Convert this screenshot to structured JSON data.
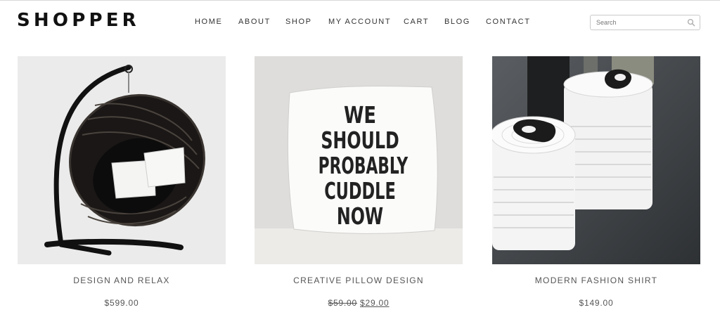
{
  "header": {
    "logo": "SHOPPER",
    "nav": [
      "HOME",
      "ABOUT",
      "SHOP",
      "MY ACCOUNT",
      "CART",
      "BLOG",
      "CONTACT"
    ],
    "search": {
      "placeholder": "Search",
      "value": ""
    }
  },
  "products": [
    {
      "name": "DESIGN AND RELAX",
      "price": "$599.00",
      "image": "hanging-egg-chair"
    },
    {
      "name": "CREATIVE PILLOW DESIGN",
      "old_price": "$59.00",
      "price": "$29.00",
      "image": "pillow",
      "pillow_text": [
        "WE",
        "SHOULD",
        "PROBABLY",
        "CUDDLE",
        "NOW"
      ]
    },
    {
      "name": "MODERN FASHION SHIRT",
      "price": "$149.00",
      "image": "white-ceramic-canisters"
    }
  ],
  "colors": {
    "text": "#333333",
    "logo": "#111111",
    "border": "#c9c9c9"
  }
}
